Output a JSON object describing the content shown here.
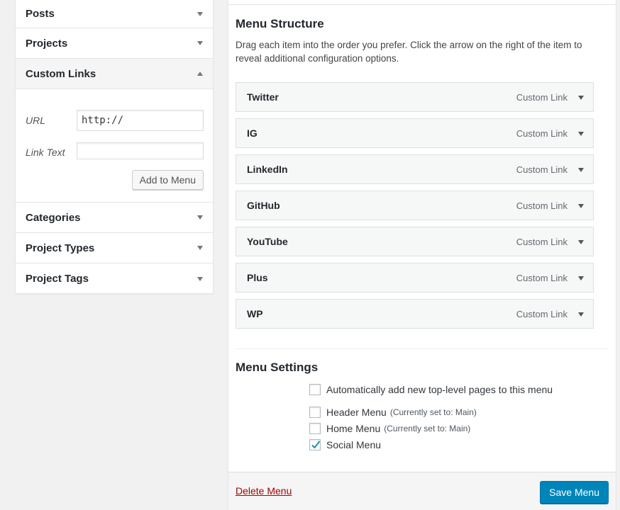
{
  "sidebar": {
    "sections": [
      {
        "label": "Posts",
        "open": false
      },
      {
        "label": "Projects",
        "open": false
      },
      {
        "label": "Custom Links",
        "open": true
      },
      {
        "label": "Categories",
        "open": false
      },
      {
        "label": "Project Types",
        "open": false
      },
      {
        "label": "Project Tags",
        "open": false
      }
    ],
    "custom_links": {
      "url_label": "URL",
      "url_value": "http://",
      "link_text_label": "Link Text",
      "link_text_value": "",
      "add_button_label": "Add to Menu"
    }
  },
  "menu_structure": {
    "title": "Menu Structure",
    "description": "Drag each item into the order you prefer. Click the arrow on the right of the item to reveal additional configuration options.",
    "items": [
      {
        "title": "Twitter",
        "type": "Custom Link"
      },
      {
        "title": "IG",
        "type": "Custom Link"
      },
      {
        "title": "LinkedIn",
        "type": "Custom Link"
      },
      {
        "title": "GitHub",
        "type": "Custom Link"
      },
      {
        "title": "YouTube",
        "type": "Custom Link"
      },
      {
        "title": "Plus",
        "type": "Custom Link"
      },
      {
        "title": "WP",
        "type": "Custom Link"
      }
    ]
  },
  "menu_settings": {
    "title": "Menu Settings",
    "auto_add": {
      "label": "Automatically add new top-level pages to this menu",
      "checked": false
    },
    "locations": [
      {
        "label": "Header Menu",
        "note": "(Currently set to: Main)",
        "checked": false
      },
      {
        "label": "Home Menu",
        "note": "(Currently set to: Main)",
        "checked": false
      },
      {
        "label": "Social Menu",
        "note": "",
        "checked": true
      }
    ]
  },
  "footer": {
    "delete_label": "Delete Menu",
    "save_label": "Save Menu"
  },
  "colors": {
    "primary_button": "#0085ba",
    "delete_link": "#aa0000",
    "checkmark": "#1e8cbe"
  }
}
